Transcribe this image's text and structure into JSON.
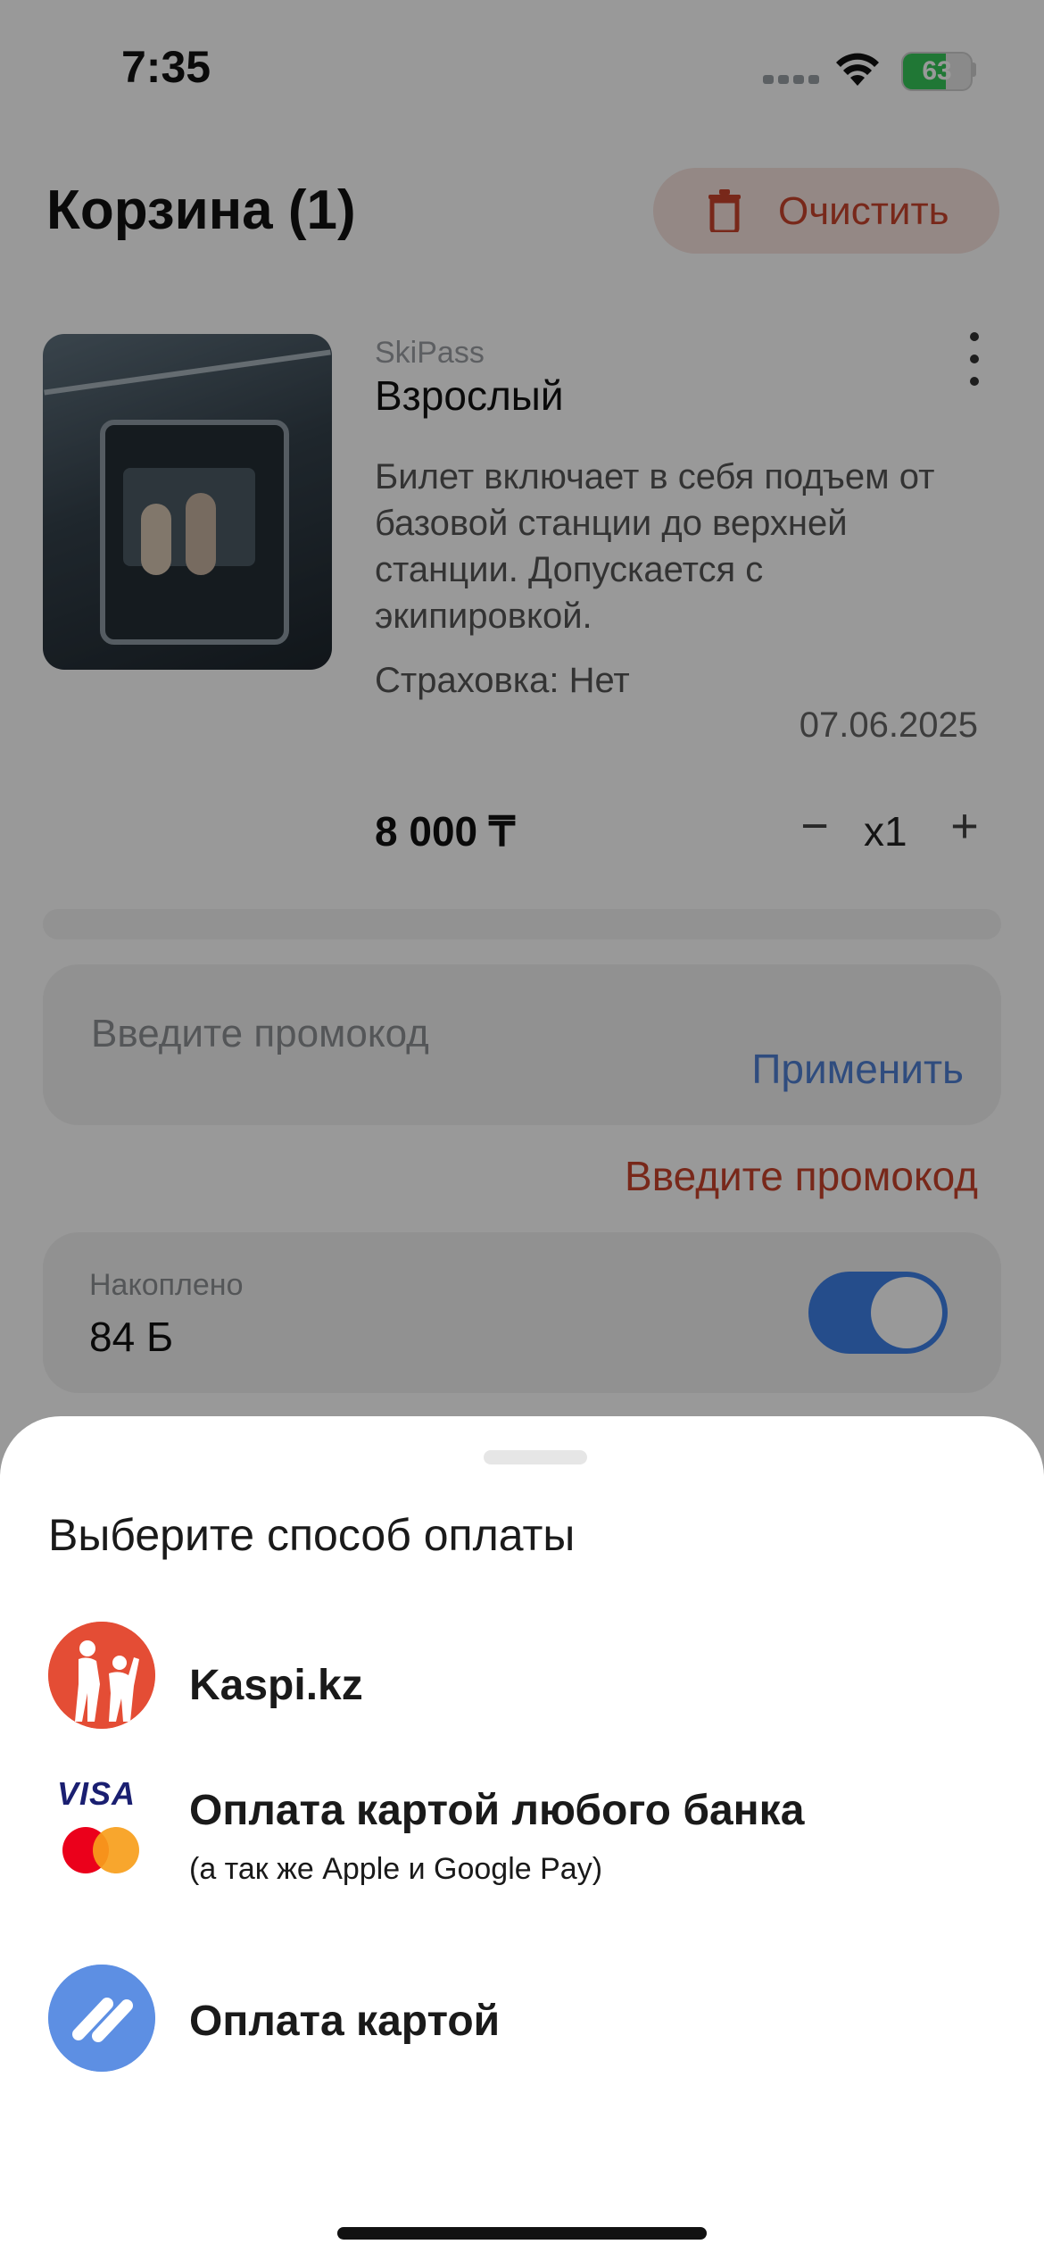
{
  "status_bar": {
    "time": "7:35",
    "battery": "63"
  },
  "header": {
    "title": "Корзина (1)",
    "clear_label": "Очистить"
  },
  "cart_item": {
    "category": "SkiPass",
    "name": "Взрослый",
    "description": "Билет включает в себя подъем от базовой станции до верхней станции. Допускается с экипировкой.",
    "insurance": "Страховка: Нет",
    "date": "07.06.2025",
    "price": "8 000 ₸",
    "quantity": "x1"
  },
  "promo": {
    "placeholder": "Введите промокод",
    "apply_label": "Применить",
    "error": "Введите промокод"
  },
  "points": {
    "label": "Накоплено",
    "value": "84 Б",
    "toggle_on": true
  },
  "payment_sheet": {
    "title": "Выберите способ оплаты",
    "options": [
      {
        "name": "Kaspi.kz",
        "icon": "kaspi-logo-icon"
      },
      {
        "name": "Оплата картой любого банка",
        "subtitle": "(а так же Apple и Google Pay)",
        "icon": "visa-mastercard-icon",
        "visa_text": "VISA"
      },
      {
        "name": "Оплата картой",
        "icon": "card-stripes-icon"
      }
    ]
  },
  "colors": {
    "accent_red": "#c9442c",
    "accent_blue": "#4f7fd3",
    "toggle_blue": "#3f80e8",
    "kaspi_red": "#e44d35"
  }
}
